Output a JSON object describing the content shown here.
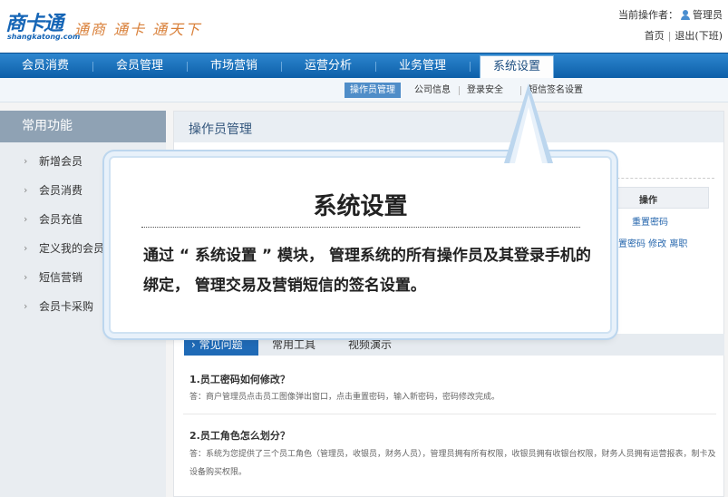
{
  "header": {
    "logo_text": "商卡通",
    "logo_domain": "shangkatong.com",
    "slogan": "通商 通卡 通天下",
    "operator_label": "当前操作者：",
    "operator_name": "管理员",
    "home_link": "首页",
    "logout_link": "退出(下班)"
  },
  "nav": {
    "items": [
      {
        "label": "会员消费"
      },
      {
        "label": "会员管理"
      },
      {
        "label": "市场营销"
      },
      {
        "label": "运营分析"
      },
      {
        "label": "业务管理"
      },
      {
        "label": "系统设置"
      }
    ]
  },
  "subnav": {
    "items": [
      {
        "label": "操作员管理"
      },
      {
        "label": "公司信息"
      },
      {
        "label": "登录安全"
      },
      {
        "label": "短信签名设置"
      }
    ]
  },
  "sidebar": {
    "title": "常用功能",
    "items": [
      {
        "label": "新增会员"
      },
      {
        "label": "会员消费"
      },
      {
        "label": "会员充值"
      },
      {
        "label": "定义我的会员卡"
      },
      {
        "label": "短信营销"
      },
      {
        "label": "会员卡采购"
      }
    ]
  },
  "main": {
    "title": "操作员管理",
    "table": {
      "header": "操作",
      "row1": "重置密码",
      "row2": "重置密码  修改  离职"
    }
  },
  "faq": {
    "tabs": [
      {
        "label": "› 常见问题"
      },
      {
        "label": "常用工具"
      },
      {
        "label": "视频演示"
      }
    ],
    "items": [
      {
        "q": "1.员工密码如何修改？",
        "a": "答：商户管理员点击员工图像弹出窗口，点击重置密码，输入新密码，密码修改完成。"
      },
      {
        "q": "2.员工角色怎么划分？",
        "a": "答：系统为您提供了三个员工角色（管理员，收银员，财务人员），管理员拥有所有权限，收银员拥有收银台权限，财务人员拥有运营报表，制卡及设备购买权限。"
      }
    ]
  },
  "callout": {
    "title": "系统设置",
    "body": "通过 “ 系统设置 ” 模块， 管理系统的所有操作员及其登录手机的绑定， 管理交易及营销短信的签名设置。"
  }
}
